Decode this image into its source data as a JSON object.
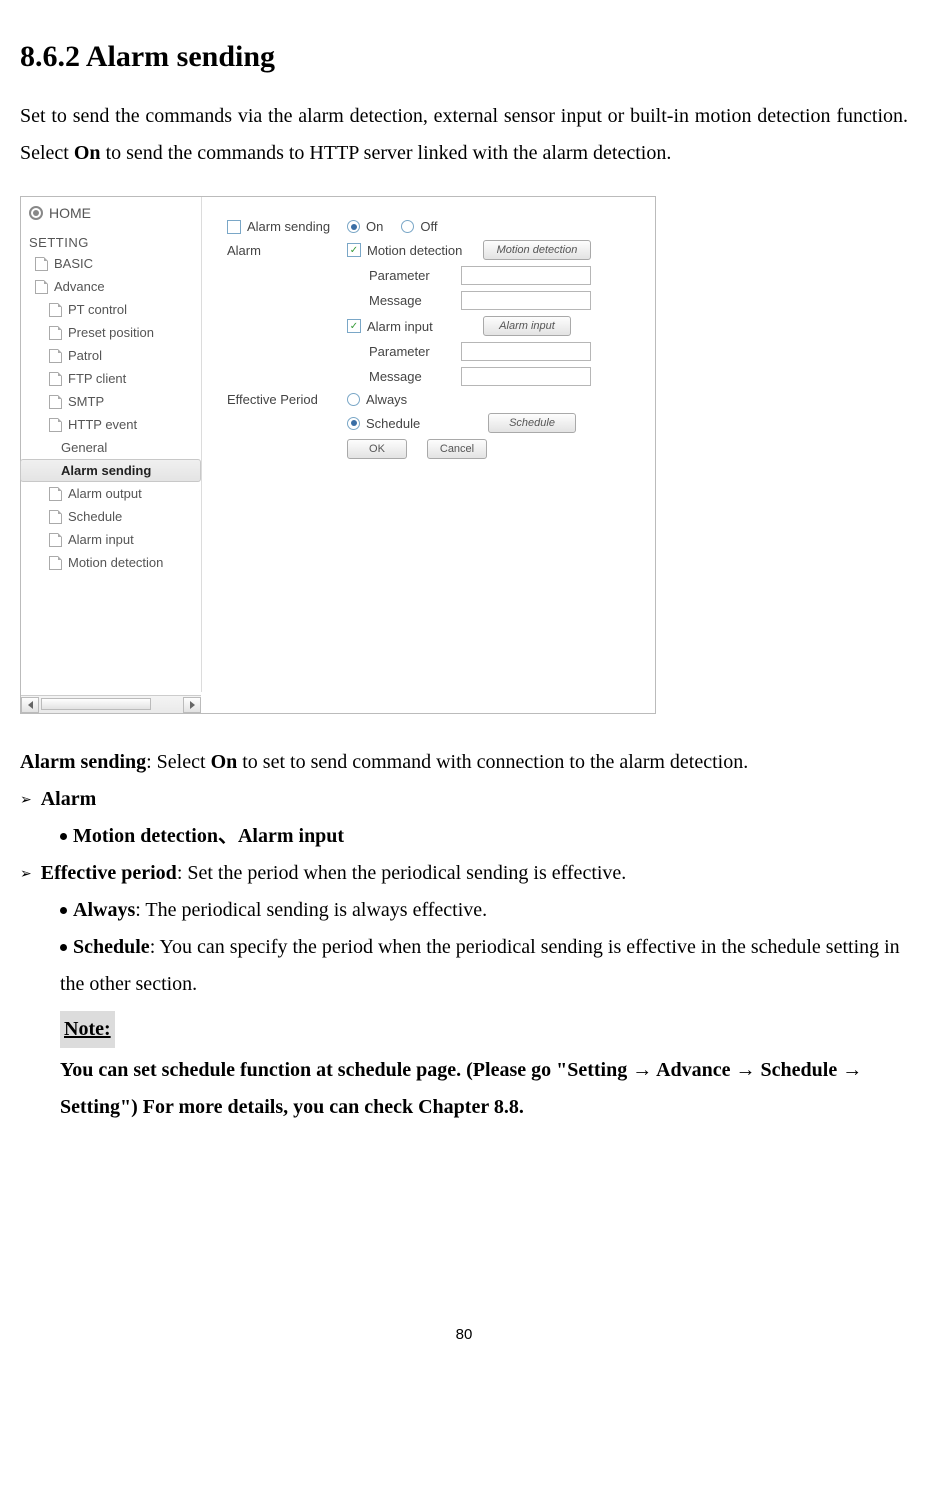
{
  "heading": "8.6.2 Alarm sending",
  "intro_before_bold": "Set to send the commands via the alarm detection, external sensor input or built-in motion detection function. Select ",
  "intro_bold": "On",
  "intro_after_bold": " to send the commands to HTTP server linked with the alarm detection.",
  "sidebar": {
    "home": "HOME",
    "setting": "SETTING",
    "basic": "BASIC",
    "advance": "Advance",
    "items": [
      "PT control",
      "Preset position",
      "Patrol",
      "FTP client",
      "SMTP",
      "HTTP event"
    ],
    "http_sub_general": "General",
    "http_sub_alarm": "Alarm sending",
    "items_after": [
      "Alarm output",
      "Schedule",
      "Alarm input",
      "Motion detection"
    ]
  },
  "panel": {
    "alarm_sending_label": "Alarm sending",
    "on_label": "On",
    "off_label": "Off",
    "alarm_label": "Alarm",
    "motion_det_label": "Motion detection",
    "motion_det_btn": "Motion detection",
    "parameter_label": "Parameter",
    "message_label": "Message",
    "alarm_input_label": "Alarm input",
    "alarm_input_btn": "Alarm input",
    "eff_period_label": "Effective Period",
    "always_label": "Always",
    "schedule_label": "Schedule",
    "schedule_btn": "Schedule",
    "ok_btn": "OK",
    "cancel_btn": "Cancel"
  },
  "desc": {
    "alarm_sending_b": "Alarm sending",
    "alarm_sending_t1": ": Select ",
    "alarm_sending_on": "On",
    "alarm_sending_t2": " to set to send command with connection to the alarm detection.",
    "alarm_hdr": "Alarm",
    "motion_alarm": "Motion detection、Alarm input",
    "eff_period_b": "Effective period",
    "eff_period_t": ": Set the period when the periodical sending is effective.",
    "always_b": "Always",
    "always_t": ": The periodical sending is always effective.",
    "schedule_b": "Schedule",
    "schedule_t": ": You can specify the period when the periodical sending is effective in the schedule setting in the other section.",
    "note_label": "Note:",
    "note_body": "You can set schedule function at schedule page. (Please go \"Setting → Advance → Schedule → Setting\") For more details, you can check Chapter 8.8."
  },
  "page_number": "80"
}
